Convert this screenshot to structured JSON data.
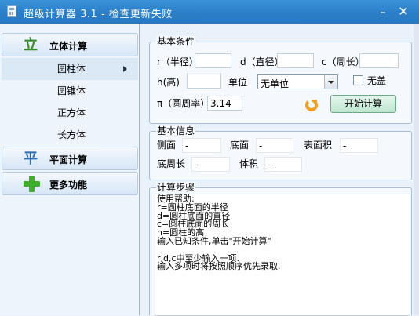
{
  "window": {
    "title": "超级计算器 3.1 - 检查更新失败",
    "minimize_glyph": "–",
    "close_glyph": "✕"
  },
  "sidebar": {
    "categories": [
      {
        "label": "立体计算",
        "icon": "solid-shape-icon",
        "icon_glyph": "立"
      },
      {
        "label": "平面计算",
        "icon": "plane-shape-icon",
        "icon_glyph": "平"
      },
      {
        "label": "更多功能",
        "icon": "plus-icon"
      }
    ],
    "sub_items": [
      {
        "label": "圆柱体",
        "active": true
      },
      {
        "label": "圆锥体",
        "active": false
      },
      {
        "label": "正方体",
        "active": false
      },
      {
        "label": "长方体",
        "active": false
      }
    ]
  },
  "basic_conditions": {
    "legend": "基本条件",
    "radius_label": "r（半径）",
    "radius_value": "",
    "diameter_label": "d（直径）",
    "diameter_value": "",
    "circumference_label": "c（周长）",
    "circumference_value": "",
    "height_label": "h(高)",
    "height_value": "",
    "unit_label": "单位",
    "unit_value": "无单位",
    "no_cap_label": "无盖",
    "no_cap_checked": false,
    "pi_label": "π（圆周率）",
    "pi_value": "3.14",
    "start_button": "开始计算"
  },
  "basic_info": {
    "legend": "基本信息",
    "side_label": "侧面",
    "side_value": "-",
    "base_label": "底面",
    "base_value": "-",
    "surface_label": "表面积",
    "surface_value": "-",
    "base_perimeter_label": "底周长",
    "base_perimeter_value": "-",
    "volume_label": "体积",
    "volume_value": "-"
  },
  "steps": {
    "legend": "计算步骤",
    "lines": [
      "使用帮助:",
      "r=圆柱底面的半径",
      "d=圆柱底面的直径",
      "c=圆柱底面的周长",
      "h=圆柱的高",
      "输入已知条件,单击\"开始计算\"",
      "",
      "r,d,c中至少输入一项.",
      "输入多项时将按照顺序优先录取."
    ]
  },
  "colors": {
    "titlebar": "#2b7fc8",
    "sidebar_bg": "#eef4fb",
    "button_green": "#bfe6cf",
    "refresh_orange": "#f0a020"
  }
}
